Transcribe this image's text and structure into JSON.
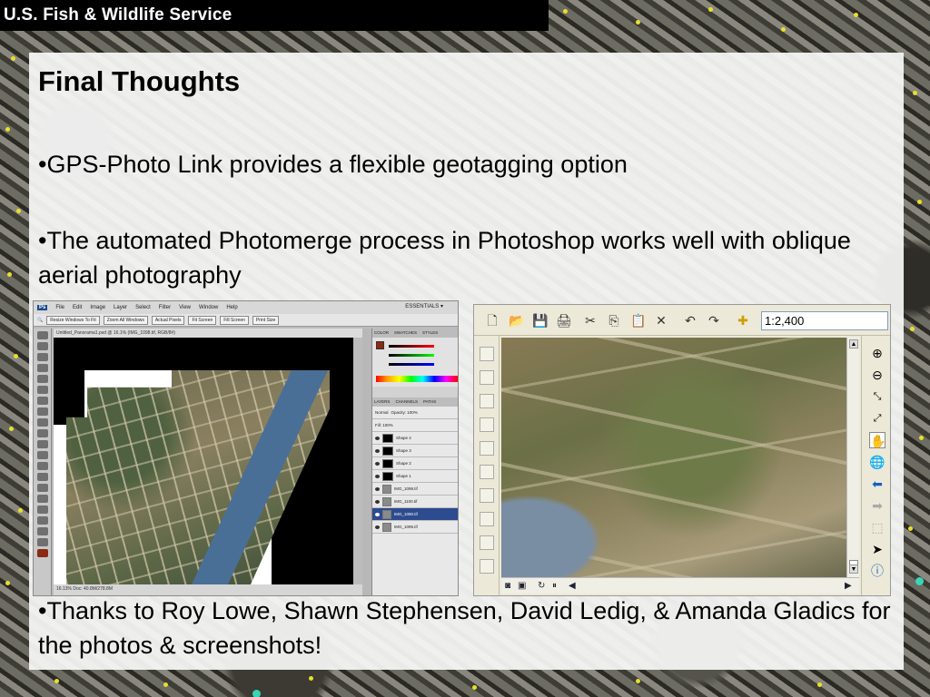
{
  "header": {
    "org_name": "U.S. Fish & Wildlife Service"
  },
  "slide": {
    "title": "Final Thoughts",
    "bullets": [
      "•GPS-Photo Link provides a flexible geotagging option",
      "•The automated Photomerge process in Photoshop works well with oblique aerial photography",
      "•Thanks to Roy Lowe, Shawn Stephensen, David Ledig, & Amanda Gladics for the photos & screenshots!"
    ]
  },
  "photoshop": {
    "logo": "Ps",
    "menu": [
      "File",
      "Edit",
      "Image",
      "Layer",
      "Select",
      "Filter",
      "View",
      "Window",
      "Help"
    ],
    "workspace": "ESSENTIALS ▾",
    "options": [
      "Resize Windows To Fit",
      "Zoom All Windows",
      "Actual Pixels",
      "Fit Screen",
      "Fill Screen",
      "Print Size"
    ],
    "doc_tab": "Untitled_Panorama1.psd @ 16.1% (IMG_1098.tif, RGB/8#)",
    "status": "16.13%   Doc: 40.8M/278.8M",
    "panel_tabs": [
      "COLOR",
      "SWATCHES",
      "STYLES"
    ],
    "layers_tabs": [
      "LAYERS",
      "CHANNELS",
      "PATHS"
    ],
    "blend_mode": "Normal",
    "opacity": "Opacity: 100%",
    "fill": "Fill: 100%",
    "layers": [
      {
        "name": "Shape 4",
        "selected": false
      },
      {
        "name": "Shape 3",
        "selected": false
      },
      {
        "name": "Shape 2",
        "selected": false
      },
      {
        "name": "Shape 1",
        "selected": false
      },
      {
        "name": "IMG_1098.tif",
        "selected": false
      },
      {
        "name": "IMG_1100.tif",
        "selected": false
      },
      {
        "name": "IMG_1090.tif",
        "selected": true
      },
      {
        "name": "IMG_1095.tif",
        "selected": false
      }
    ]
  },
  "gis": {
    "scale_value": "1:2,400",
    "toolbar_icons": [
      "new-document-icon",
      "open-folder-icon",
      "save-icon",
      "print-icon",
      "cut-icon",
      "copy-icon",
      "paste-icon",
      "delete-icon",
      "undo-icon",
      "redo-icon",
      "add-data-icon"
    ],
    "right_tools": [
      "zoom-in-icon",
      "zoom-out-icon",
      "fixed-zoom-in-icon",
      "fixed-zoom-out-icon",
      "pan-hand-icon",
      "full-extent-globe-icon",
      "back-extent-icon",
      "forward-extent-icon",
      "select-features-icon",
      "select-arrow-icon",
      "identify-icon"
    ],
    "selected_tool": "pan-hand-icon"
  }
}
